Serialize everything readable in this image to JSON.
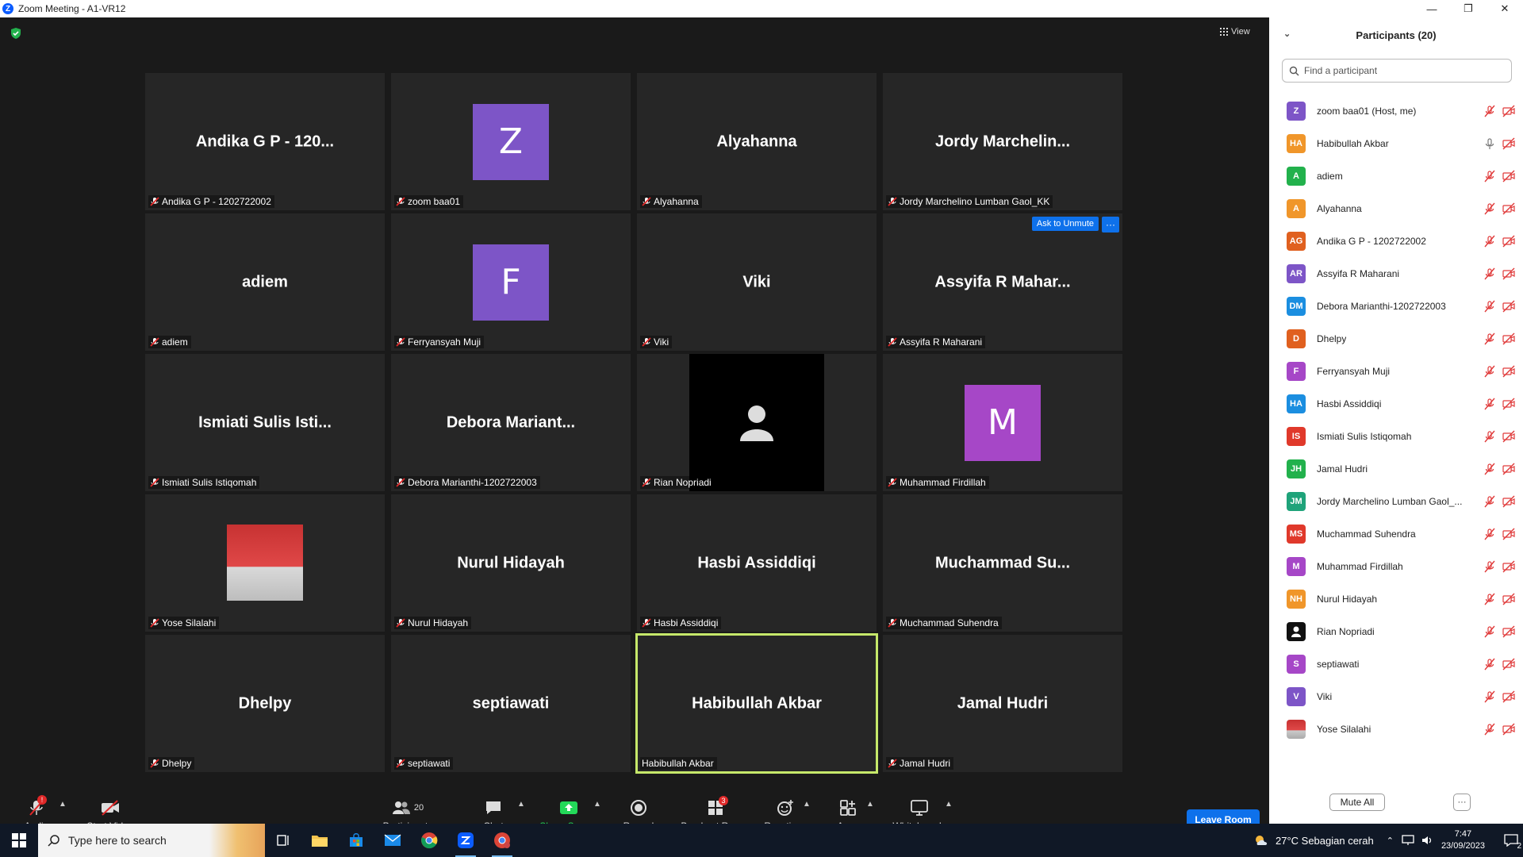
{
  "window": {
    "title": "Zoom Meeting - A1-VR12",
    "logo_letter": "Z"
  },
  "header": {
    "view_label": "View"
  },
  "tiles": [
    {
      "big": "Andika G P - 120...",
      "name": "Andika G P - 1202722002",
      "type": "name"
    },
    {
      "letter": "Z",
      "name": "zoom baa01",
      "type": "avatar",
      "color": "#7d55c7"
    },
    {
      "big": "Alyahanna",
      "name": "Alyahanna",
      "type": "name"
    },
    {
      "big": "Jordy  Marchelin...",
      "name": "Jordy Marchelino Lumban Gaol_KK",
      "type": "name"
    },
    {
      "big": "adiem",
      "name": "adiem",
      "type": "name"
    },
    {
      "letter": "F",
      "name": "Ferryansyah Muji",
      "type": "avatar",
      "color": "#7d55c7"
    },
    {
      "big": "Viki",
      "name": "Viki",
      "type": "name"
    },
    {
      "big": "Assyifa  R  Mahar...",
      "name": "Assyifa R Maharani",
      "type": "name"
    },
    {
      "big": "Ismiati  Sulis  Isti...",
      "name": "Ismiati Sulis Istiqomah",
      "type": "name"
    },
    {
      "big": "Debora  Mariant...",
      "name": "Debora Marianthi-1202722003",
      "type": "name"
    },
    {
      "name": "Rian Nopriadi",
      "type": "video-off"
    },
    {
      "letter": "M",
      "name": "Muhammad Firdillah",
      "type": "avatar",
      "color": "#a647c7"
    },
    {
      "name": "Yose Silalahi",
      "type": "photo"
    },
    {
      "big": "Nurul Hidayah",
      "name": "Nurul Hidayah",
      "type": "name"
    },
    {
      "big": "Hasbi  Assiddiqi",
      "name": "Hasbi Assiddiqi",
      "type": "name"
    },
    {
      "big": "Muchammad  Su...",
      "name": "Muchammad Suhendra",
      "type": "name"
    },
    {
      "big": "Dhelpy",
      "name": "Dhelpy",
      "type": "name"
    },
    {
      "big": "septiawati",
      "name": "septiawati",
      "type": "name"
    },
    {
      "big": "Habibullah  Akbar",
      "name": "Habibullah Akbar",
      "type": "name",
      "active": true
    },
    {
      "big": "Jamal Hudri",
      "name": "Jamal Hudri",
      "type": "name"
    }
  ],
  "tile_actions": {
    "ask_unmute": "Ask to Unmute",
    "more": "···"
  },
  "toolbar": {
    "audio": "Audio",
    "audio_badge": "!",
    "start_video": "Start Video",
    "participants": "Participants",
    "participants_count": "20",
    "chat": "Chat",
    "share_screen": "Share Screen",
    "record": "Record",
    "breakout_rooms": "Breakout Rooms",
    "breakout_badge": "3",
    "reactions": "Reactions",
    "apps": "Apps",
    "whiteboards": "Whiteboards",
    "leave": "Leave Room"
  },
  "panel": {
    "title": "Participants (20)",
    "search_placeholder": "Find a participant",
    "mute_all": "Mute All",
    "more": "···",
    "participants": [
      {
        "initials": "Z",
        "name": "zoom baa01 (Host, me)",
        "color": "#7d55c7",
        "mic": "muted",
        "video": false
      },
      {
        "initials": "HA",
        "name": "Habibullah Akbar",
        "color": "#f0962a",
        "mic": "on",
        "video": true
      },
      {
        "initials": "A",
        "name": "adiem",
        "color": "#22b14c",
        "mic": "muted",
        "video": true
      },
      {
        "initials": "A",
        "name": "Alyahanna",
        "color": "#f0962a",
        "mic": "muted",
        "video": true
      },
      {
        "initials": "AG",
        "name": "Andika G P - 1202722002",
        "color": "#e0601f",
        "mic": "muted",
        "video": true
      },
      {
        "initials": "AR",
        "name": "Assyifa R Maharani",
        "color": "#7d55c7",
        "mic": "muted",
        "video": true
      },
      {
        "initials": "DM",
        "name": "Debora Marianthi-1202722003",
        "color": "#1b8ee0",
        "mic": "muted",
        "video": true
      },
      {
        "initials": "D",
        "name": "Dhelpy",
        "color": "#e0601f",
        "mic": "muted",
        "video": true
      },
      {
        "initials": "F",
        "name": "Ferryansyah Muji",
        "color": "#a647c7",
        "mic": "muted",
        "video": true
      },
      {
        "initials": "HA",
        "name": "Hasbi Assiddiqi",
        "color": "#1b8ee0",
        "mic": "muted",
        "video": true
      },
      {
        "initials": "IS",
        "name": "Ismiati Sulis Istiqomah",
        "color": "#e0392b",
        "mic": "muted",
        "video": true
      },
      {
        "initials": "JH",
        "name": "Jamal Hudri",
        "color": "#22b14c",
        "mic": "muted",
        "video": true
      },
      {
        "initials": "JM",
        "name": "Jordy Marchelino Lumban Gaol_...",
        "color": "#1fa37a",
        "mic": "muted",
        "video": true
      },
      {
        "initials": "MS",
        "name": "Muchammad Suhendra",
        "color": "#e0392b",
        "mic": "muted",
        "video": true
      },
      {
        "initials": "M",
        "name": "Muhammad Firdillah",
        "color": "#a647c7",
        "mic": "muted",
        "video": true
      },
      {
        "initials": "NH",
        "name": "Nurul Hidayah",
        "color": "#f0962a",
        "mic": "muted",
        "video": true
      },
      {
        "initials": "",
        "name": "Rian Nopriadi",
        "color": "#111111",
        "mic": "muted",
        "video": true
      },
      {
        "initials": "S",
        "name": "septiawati",
        "color": "#a647c7",
        "mic": "muted",
        "video": true
      },
      {
        "initials": "V",
        "name": "Viki",
        "color": "#7d55c7",
        "mic": "muted",
        "video": true
      },
      {
        "initials": "",
        "name": "Yose Silalahi",
        "color": "#c44",
        "mic": "muted",
        "video": true
      }
    ]
  },
  "taskbar": {
    "search_placeholder": "Type here to search",
    "weather": "27°C  Sebagian cerah",
    "time": "7:47",
    "date": "23/09/2023",
    "notif_count": "2"
  }
}
